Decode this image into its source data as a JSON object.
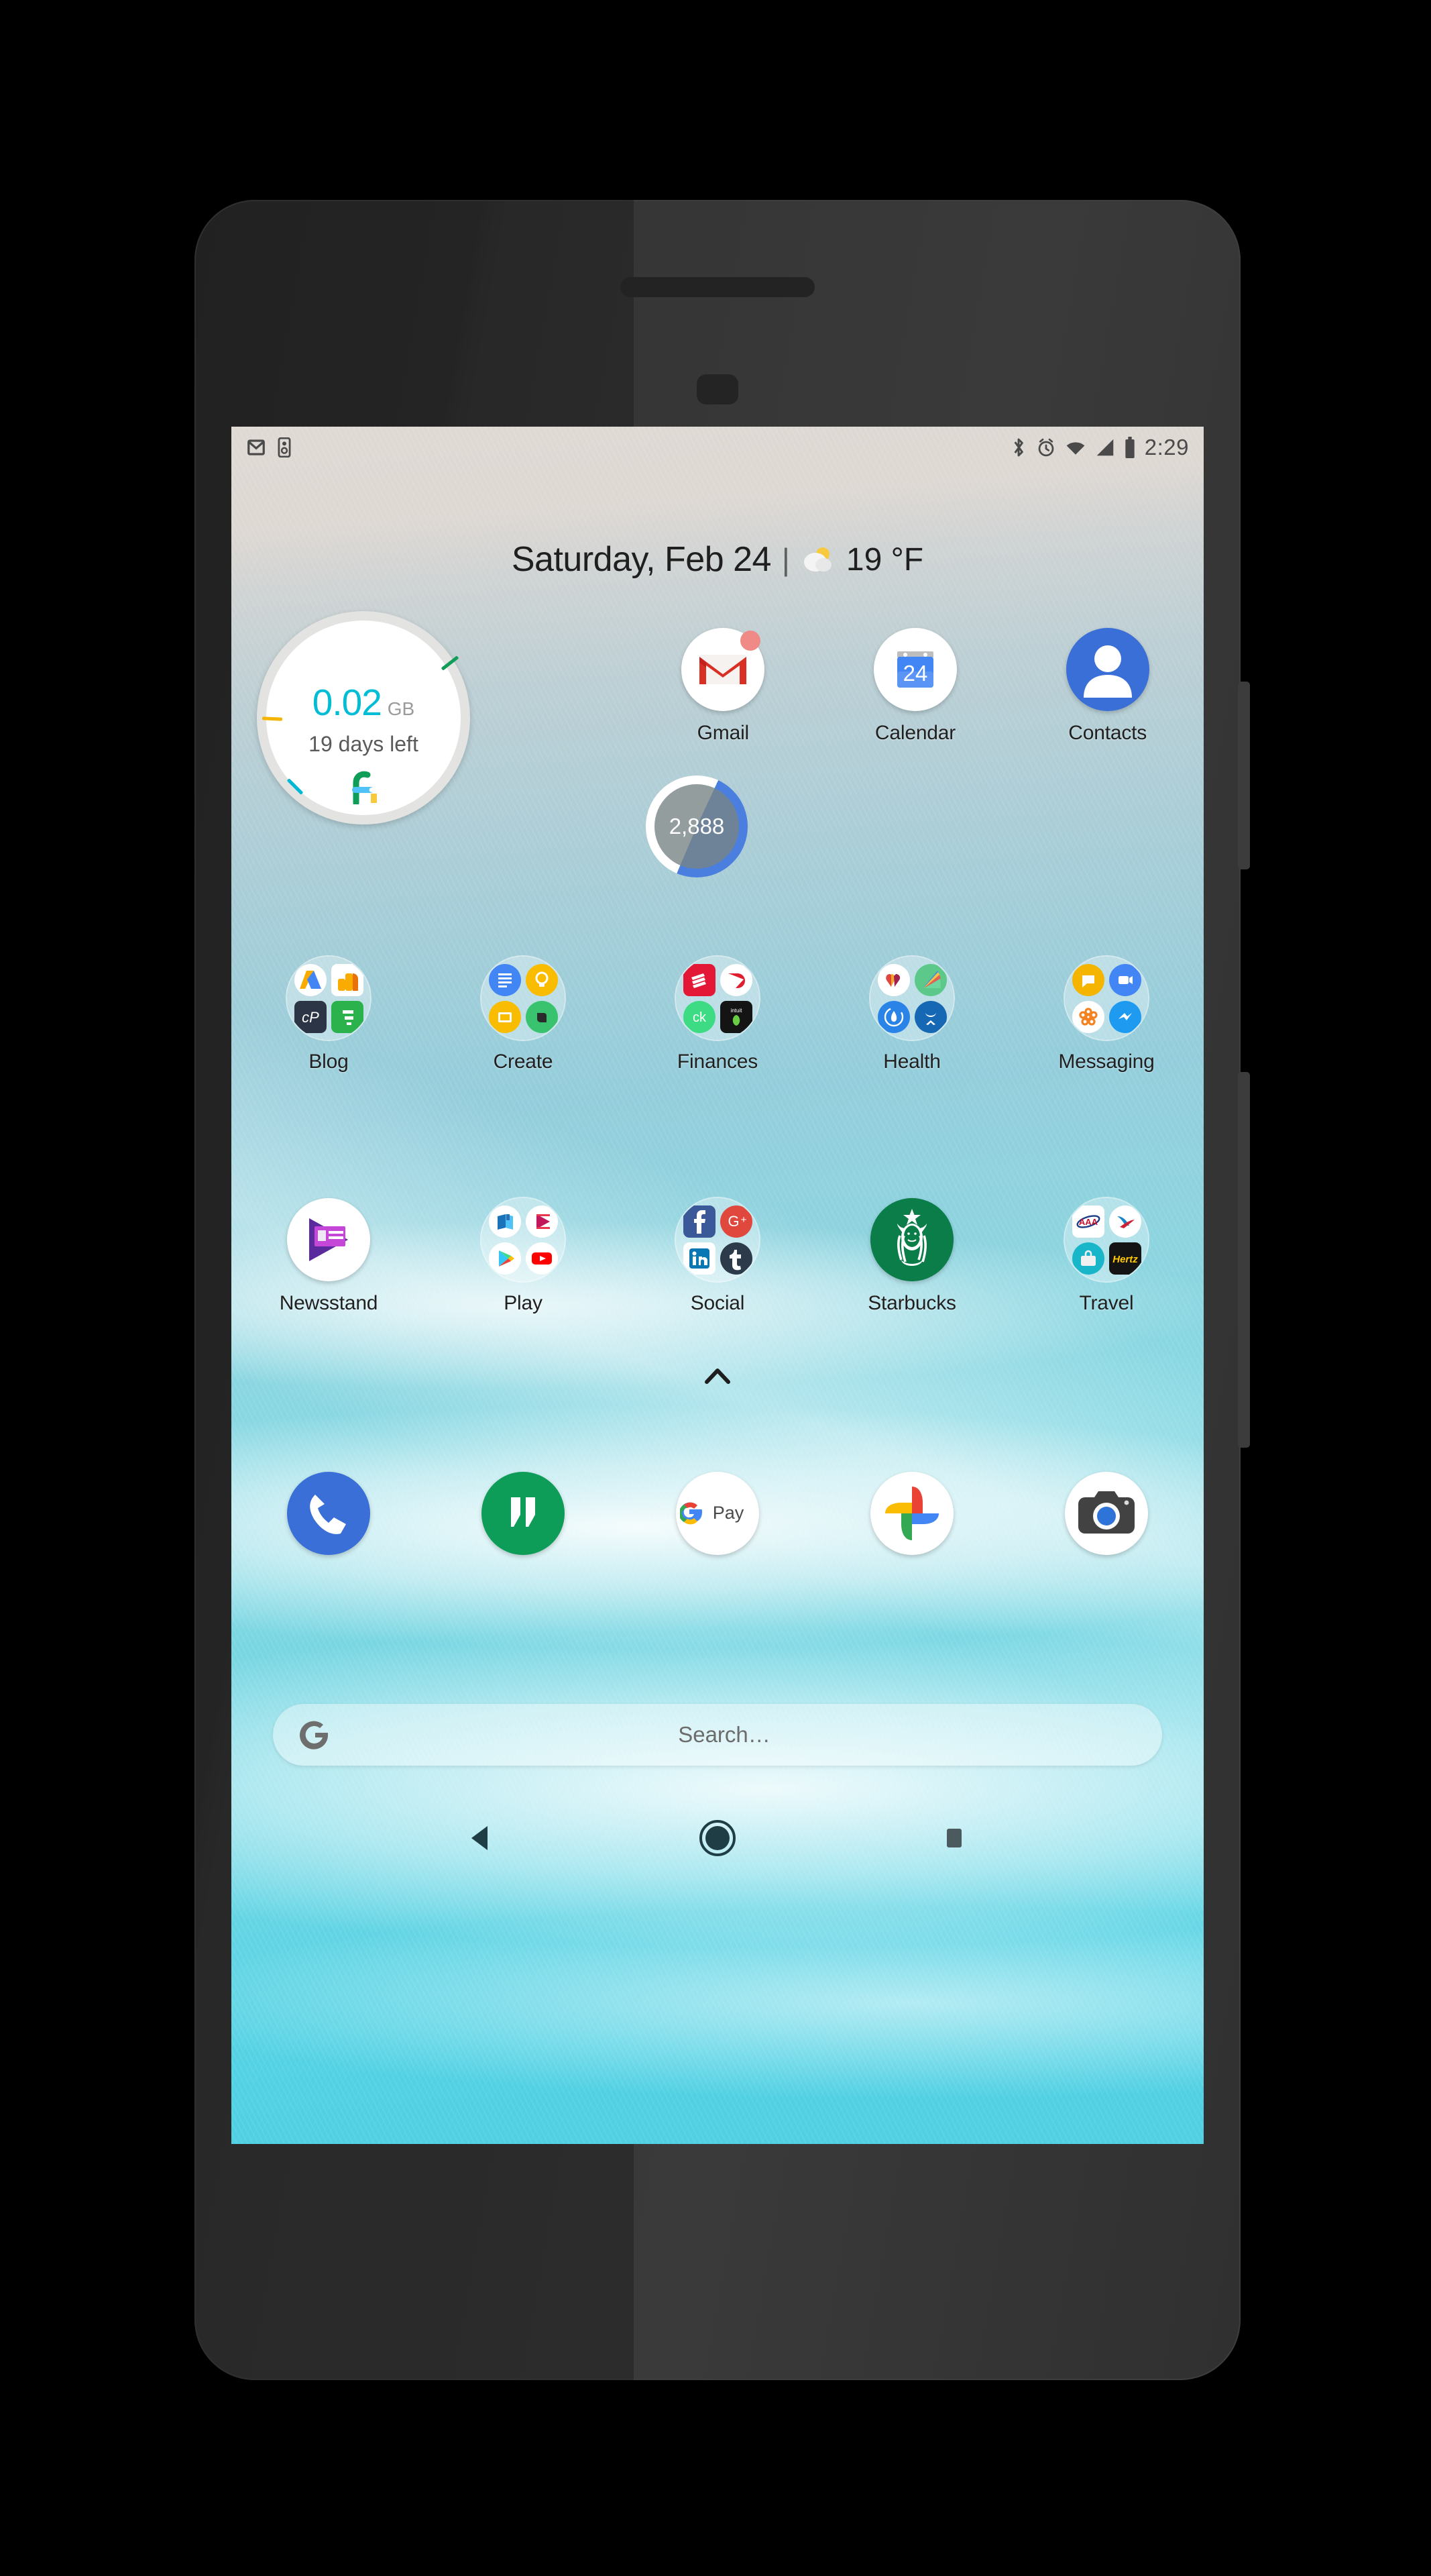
{
  "status_bar": {
    "left_icons": [
      "gmail-icon",
      "fitness-icon"
    ],
    "right_icons": [
      "bluetooth-icon",
      "alarm-icon",
      "wifi-icon",
      "cellular-signal-icon",
      "battery-icon"
    ],
    "time": "2:29"
  },
  "date_weather": {
    "date": "Saturday, Feb 24",
    "separator": "|",
    "weather_icon": "partly-cloudy-icon",
    "temperature": "19 °F"
  },
  "fi_widget": {
    "usage_value": "0.02",
    "usage_unit": "GB",
    "days_left": "19 days left",
    "logo": "google-fi-logo",
    "accent_color": "#00bcd4",
    "tick_colors": [
      "#0f9d58",
      "#f4b400",
      "#00b8d4"
    ]
  },
  "steps_widget": {
    "count": "2,888",
    "progress_color": "#4a7fe0",
    "progress_percent": 49
  },
  "row_top": [
    {
      "label": "Gmail",
      "icon": "gmail-icon",
      "badge": true
    },
    {
      "label": "Calendar",
      "icon": "calendar-icon",
      "day": "24"
    },
    {
      "label": "Contacts",
      "icon": "contacts-icon"
    }
  ],
  "folders_row_1": [
    {
      "label": "Blog",
      "apps": [
        "adsense-icon",
        "analytics-icon",
        "cpanel-icon",
        "feedly-icon"
      ]
    },
    {
      "label": "Create",
      "apps": [
        "docs-icon",
        "keep-icon",
        "slides-icon",
        "evernote-icon"
      ]
    },
    {
      "label": "Finances",
      "apps": [
        "bank-of-america-icon",
        "discover-icon",
        "credit-karma-icon",
        "mint-icon"
      ]
    },
    {
      "label": "Health",
      "apps": [
        "heart-icon",
        "fan-chart-icon",
        "water-drop-icon",
        "under-armour-icon"
      ]
    },
    {
      "label": "Messaging",
      "apps": [
        "hangouts-icon",
        "duo-icon",
        "flower-icon",
        "messenger-icon"
      ]
    }
  ],
  "folders_row_2": [
    {
      "label": "Newsstand",
      "apps": [
        "newsstand-icon"
      ],
      "single": true
    },
    {
      "label": "Play",
      "apps": [
        "play-books-icon",
        "play-movies-icon",
        "play-store-icon",
        "youtube-icon"
      ]
    },
    {
      "label": "Social",
      "apps": [
        "facebook-icon",
        "google-plus-icon",
        "linkedin-icon",
        "tumblr-icon"
      ]
    },
    {
      "label": "Starbucks",
      "apps": [
        "starbucks-icon"
      ],
      "single": true
    },
    {
      "label": "Travel",
      "apps": [
        "aaa-icon",
        "american-airlines-icon",
        "tripit-icon",
        "hertz-icon"
      ]
    }
  ],
  "drawer": {
    "chevron": "chevron-up-icon"
  },
  "dock": [
    {
      "name": "Phone",
      "icon": "phone-icon"
    },
    {
      "name": "Hangouts",
      "icon": "hangouts-icon"
    },
    {
      "name": "Google Pay",
      "icon": "google-pay-icon",
      "text": "Pay"
    },
    {
      "name": "Photos",
      "icon": "google-photos-icon"
    },
    {
      "name": "Camera",
      "icon": "camera-icon"
    }
  ],
  "search": {
    "logo": "google-g-icon",
    "placeholder": "Search…"
  },
  "nav_bar": {
    "back": "back-triangle-icon",
    "home": "home-circle-icon",
    "recents": "recents-square-icon"
  }
}
